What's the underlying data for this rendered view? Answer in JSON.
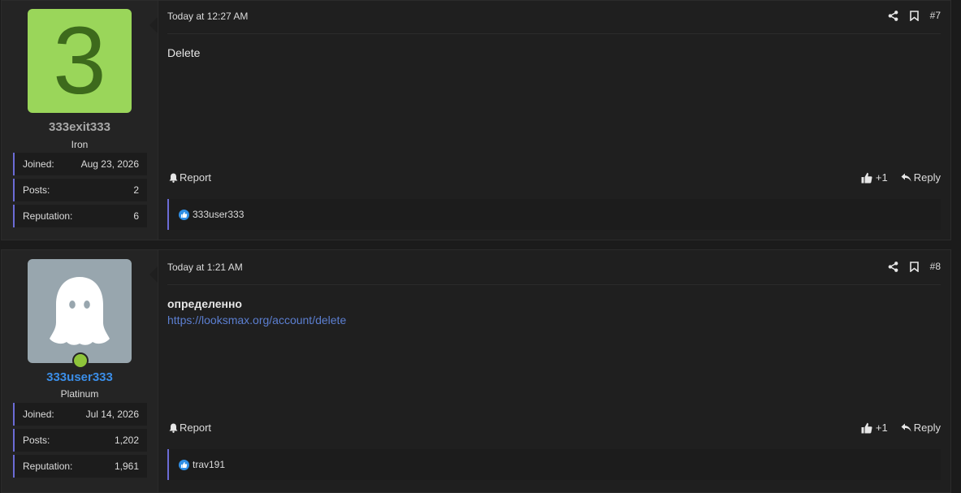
{
  "posts": [
    {
      "user": {
        "avatar_letter": "3",
        "avatar_bg": "#9ad65a",
        "name": "333exit333",
        "name_color": "#a8a8a8",
        "rank": "Iron",
        "stats": [
          {
            "label": "Joined:",
            "value": "Aug 23, 2026"
          },
          {
            "label": "Posts:",
            "value": "2"
          },
          {
            "label": "Reputation:",
            "value": "6"
          }
        ]
      },
      "date": "Today at 12:27 AM",
      "number": "#7",
      "body_text": "Delete",
      "report_label": "Report",
      "like_count": "+1",
      "reply_label": "Reply",
      "reaction_users": "333user333"
    },
    {
      "user": {
        "avatar_bg": "#98a6ae",
        "name": "333user333",
        "name_color": "#3b8ee8",
        "rank": "Platinum",
        "online": true,
        "stats": [
          {
            "label": "Joined:",
            "value": "Jul 14, 2026"
          },
          {
            "label": "Posts:",
            "value": "1,202"
          },
          {
            "label": "Reputation:",
            "value": "1,961"
          }
        ]
      },
      "date": "Today at 1:21 AM",
      "number": "#8",
      "body_strong": "определенно",
      "body_link": "https://looksmax.org/account/delete",
      "report_label": "Report",
      "like_count": "+1",
      "reply_label": "Reply",
      "reaction_users": "trav191"
    }
  ],
  "icons": {
    "share": "share-icon",
    "bookmark": "bookmark-icon",
    "report": "bell-icon",
    "like": "thumbs-up-icon",
    "reply": "reply-arrow-icon",
    "reaction": "like-reaction-icon"
  }
}
